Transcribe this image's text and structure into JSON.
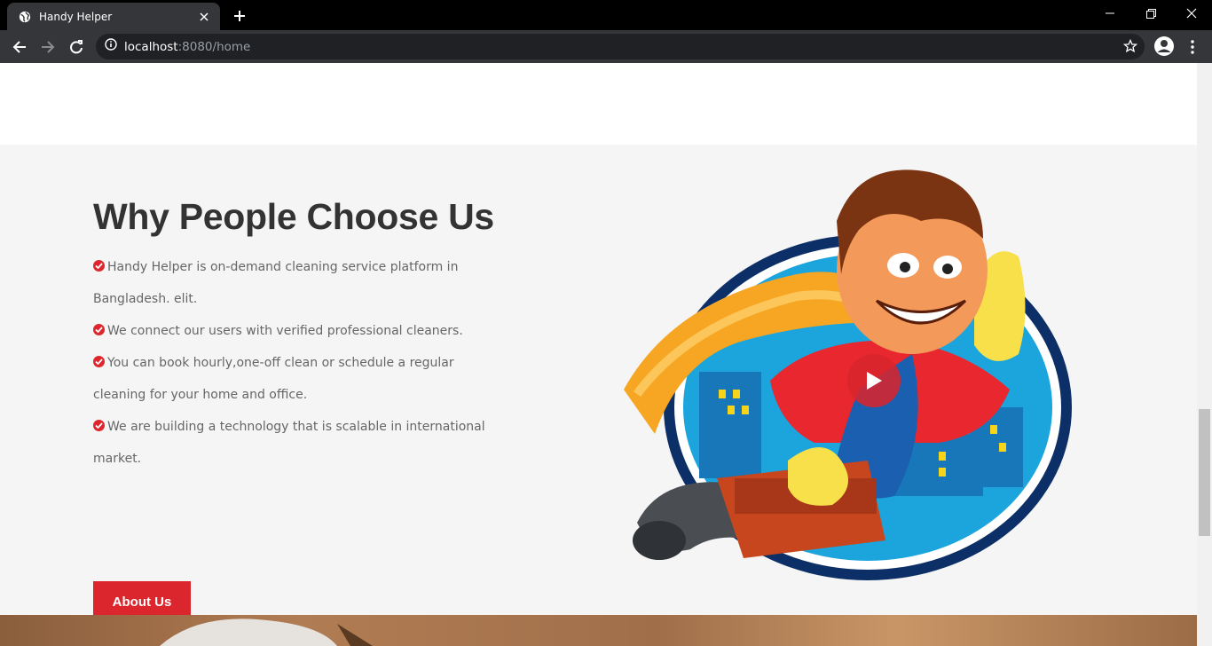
{
  "browser": {
    "tab_title": "Handy Helper",
    "url_host": "localhost",
    "url_path": ":8080/home"
  },
  "section": {
    "title": "Why People Choose Us",
    "points": [
      "Handy Helper is on-demand cleaning service platform in Bangladesh. elit.",
      "We connect our users with verified professional cleaners.",
      "You can book hourly,one-off clean or schedule a regular cleaning for your home and office.",
      "We are building a technology that is scalable in international market."
    ],
    "button_label": "About Us"
  },
  "colors": {
    "accent": "#dc262d",
    "title": "#333333",
    "text": "#666666",
    "section_bg": "#f5f5f5"
  },
  "icons": [
    "globe-icon",
    "close-icon",
    "plus-icon",
    "back-icon",
    "forward-icon",
    "reload-icon",
    "info-icon",
    "star-icon",
    "profile-icon",
    "kebab-icon",
    "check-circle-icon",
    "play-icon"
  ]
}
